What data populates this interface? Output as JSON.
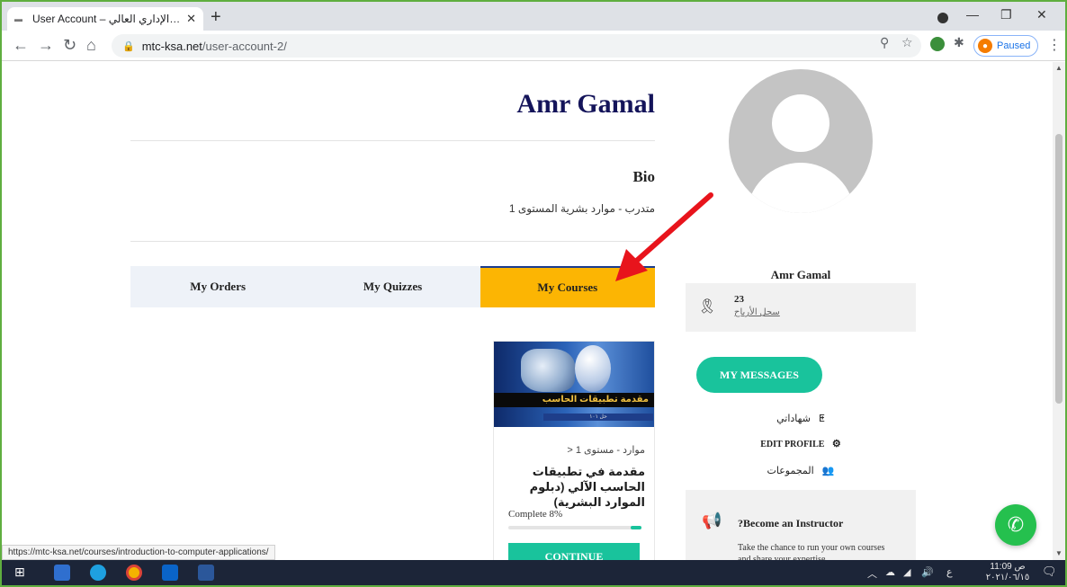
{
  "browser": {
    "tab_title": "User Account – ريب الإداري العالي",
    "new_tab_label": "+",
    "url_host": "mtc-ksa.net",
    "url_path": "/user-account-2/",
    "profile_status": "Paused",
    "status_bar_url": "https://mtc-ksa.net/courses/introduction-to-computer-applications/"
  },
  "profile": {
    "name": "Amr Gamal",
    "bio_heading": "Bio",
    "bio_text": "متدرب - موارد بشرية المستوى 1"
  },
  "tabs": [
    {
      "label": "My Orders",
      "active": false
    },
    {
      "label": "My Quizzes",
      "active": false
    },
    {
      "label": "My Courses",
      "active": true
    }
  ],
  "course": {
    "thumb_banner": "مقدمة تطبيقات الحاسب",
    "thumb_sub": "حل ١٠١",
    "breadcrumb": "موارد - مستوى 1 <",
    "title": "مقدمة في تطبيقات الحاسب الآلي (دبلوم الموارد البشرية)",
    "complete_label": "Complete 8%",
    "progress_percent": 8,
    "continue_label": "CONTINUE"
  },
  "sidebar": {
    "name": "Amr Gamal",
    "points_value": "23",
    "points_label": "سجل الأرباح",
    "messages_button": "MY MESSAGES",
    "certificates_link": "شهاداتي",
    "edit_profile_link": "EDIT PROFILE",
    "groups_link": "المجموعات",
    "instructor_heading": "?Become an Instructor",
    "instructor_text": "Take the chance to run your own courses and share your expertise"
  },
  "taskbar": {
    "lang": "ع",
    "time": "11:09 ص",
    "date": "٢٠٢١/٠٦/١٥"
  },
  "colors": {
    "accent_yellow": "#fcb503",
    "accent_green": "#19c39c",
    "title_navy": "#14145a",
    "arrow_red": "#e8141c"
  }
}
